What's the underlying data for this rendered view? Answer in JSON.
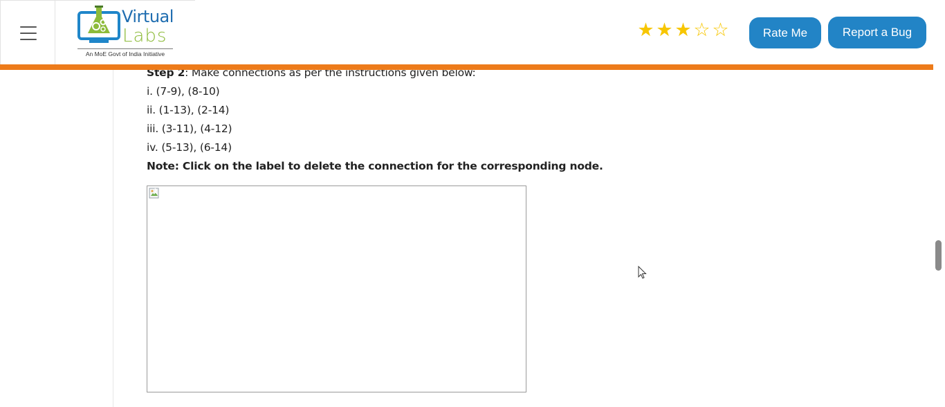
{
  "header": {
    "menu_icon": "hamburger-menu-icon",
    "logo": {
      "word1": "Virtual",
      "word2": "Labs",
      "tagline": "An MoE Govt of India Initiative"
    },
    "rating": {
      "value": 3,
      "max": 5,
      "star_color": "#f7c600"
    },
    "rate_button": "Rate Me",
    "bug_button": "Report a Bug",
    "accent_bar_color": "#ed7b1a",
    "button_color": "#2284c6"
  },
  "content": {
    "step_label": "Step 2",
    "step_text": ": Make connections as per the instructions given below:",
    "instructions": [
      "i. (7-9), (8-10)",
      "ii. (1-13), (2-14)",
      "iii. (3-11), (4-12)",
      "iv. (5-13), (6-14)"
    ],
    "note": "Note: Click on the label to delete the connection for the corresponding node.",
    "image_icon": "broken-image-icon"
  }
}
